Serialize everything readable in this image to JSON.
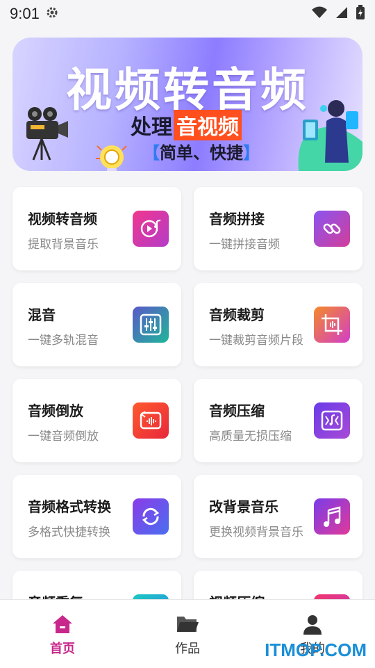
{
  "status_bar": {
    "time": "9:01"
  },
  "banner": {
    "title": "视频转音频",
    "subtitle_prefix": "处理",
    "subtitle_highlight": "音视频",
    "bracket_open": "【",
    "bracket_close": "】",
    "tagline": "简单、快捷"
  },
  "tools": [
    {
      "title": "视频转音频",
      "subtitle": "提取背景音乐",
      "icon": "video-to-audio-icon",
      "color": "#d0329a"
    },
    {
      "title": "音频拼接",
      "subtitle": "一键拼接音频",
      "icon": "link-icon",
      "color": "#a245d6"
    },
    {
      "title": "混音",
      "subtitle": "一键多轨混音",
      "icon": "mixer-icon",
      "color": "#2a9d8f"
    },
    {
      "title": "音频裁剪",
      "subtitle": "一键裁剪音频片段",
      "icon": "crop-icon",
      "color": "#f0781e"
    },
    {
      "title": "音频倒放",
      "subtitle": "一键音频倒放",
      "icon": "reverse-icon",
      "color": "#f03a2e"
    },
    {
      "title": "音频压缩",
      "subtitle": "高质量无损压缩",
      "icon": "compress-icon",
      "color": "#7b3fe4"
    },
    {
      "title": "音频格式转换",
      "subtitle": "多格式快捷转换",
      "icon": "convert-icon",
      "color": "#6c4ce8"
    },
    {
      "title": "改背景音乐",
      "subtitle": "更换视频背景音乐",
      "icon": "music-icon",
      "color": "#b43cc8"
    },
    {
      "title": "音频重复",
      "subtitle": "",
      "icon": "repeat-icon",
      "color": "#1cb8b8"
    },
    {
      "title": "视频压缩",
      "subtitle": "",
      "icon": "video-compress-icon",
      "color": "#e8367a"
    }
  ],
  "tabbar": {
    "home": "首页",
    "works": "作品",
    "mine": "我的",
    "active_color": "#c8288c"
  },
  "watermark": "ITMOP.COM"
}
